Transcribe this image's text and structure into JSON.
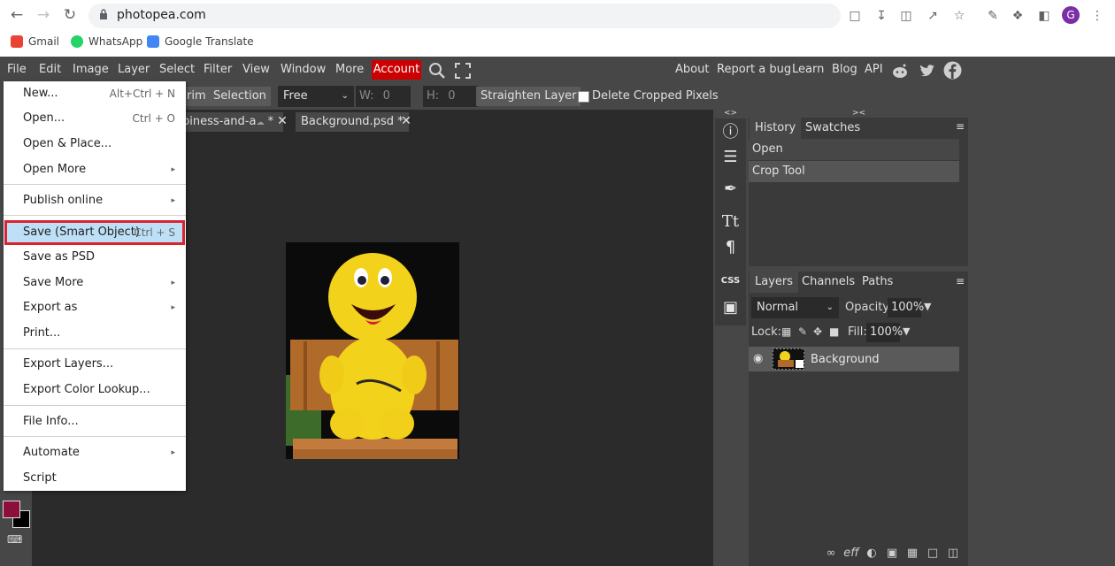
{
  "browser": {
    "url": "photopea.com",
    "avatar_letter": "G",
    "bookmarks": [
      {
        "label": "Gmail",
        "icon": "gmail-icon"
      },
      {
        "label": "WhatsApp",
        "icon": "whatsapp-icon"
      },
      {
        "label": "Google Translate",
        "icon": "google-translate-icon"
      }
    ]
  },
  "menubar": {
    "items": [
      "File",
      "Edit",
      "Image",
      "Layer",
      "Select",
      "Filter",
      "View",
      "Window",
      "More"
    ],
    "account": "Account",
    "right": [
      "About",
      "Report a bug",
      "Learn",
      "Blog",
      "API"
    ]
  },
  "options": {
    "trim": "rim",
    "selection": "Selection",
    "ratio": "Free",
    "w_label": "W:",
    "w_value": "0",
    "h_label": "H:",
    "h_value": "0",
    "straighten": "Straighten Layer",
    "delete_cropped": "Delete Cropped Pixels"
  },
  "documents": {
    "tab1": "piness-and-a",
    "tab1_suffix": " *",
    "tab2": "Background.psd *"
  },
  "history": {
    "tabs": [
      "History",
      "Swatches"
    ],
    "rows": [
      "Open",
      "Crop Tool"
    ]
  },
  "layers": {
    "tabs": [
      "Layers",
      "Channels",
      "Paths"
    ],
    "blend_mode": "Normal",
    "opacity_label": "Opacity:",
    "opacity_value": "100%",
    "lock_label": "Lock:",
    "fill_label": "Fill:",
    "fill_value": "100%",
    "layer_name": "Background"
  },
  "strip": {
    "css_label": "CSS"
  },
  "file_menu": {
    "items": [
      {
        "label": "New...",
        "shortcut": "Alt+Ctrl + N"
      },
      {
        "label": "Open...",
        "shortcut": "Ctrl + O"
      },
      {
        "label": "Open & Place...",
        "shortcut": ""
      },
      {
        "label": "Open More",
        "submenu": true
      },
      {
        "label": "Publish online",
        "submenu": true
      },
      {
        "label": "Save (Smart Object)",
        "shortcut": "Ctrl + S",
        "highlighted": true
      },
      {
        "label": "Save as PSD",
        "shortcut": ""
      },
      {
        "label": "Save More",
        "submenu": true
      },
      {
        "label": "Export as",
        "submenu": true
      },
      {
        "label": "Print...",
        "shortcut": ""
      },
      {
        "label": "Export Layers...",
        "shortcut": ""
      },
      {
        "label": "Export Color Lookup...",
        "shortcut": ""
      },
      {
        "label": "File Info...",
        "shortcut": ""
      },
      {
        "label": "Automate",
        "submenu": true
      },
      {
        "label": "Script",
        "shortcut": ""
      }
    ],
    "submenu_arrow": "▸"
  },
  "colors": {
    "foreground": "#8b0f3a",
    "background": "#000000",
    "account": "#cc0000",
    "highlight_border": "#d9232e"
  }
}
